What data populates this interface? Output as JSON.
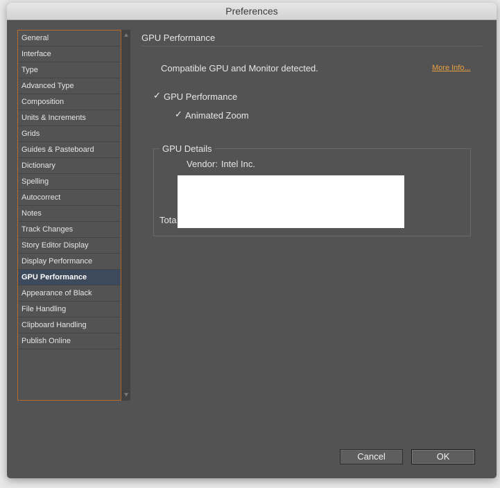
{
  "window": {
    "title": "Preferences"
  },
  "sidebar": {
    "items": [
      {
        "label": "General"
      },
      {
        "label": "Interface"
      },
      {
        "label": "Type"
      },
      {
        "label": "Advanced Type"
      },
      {
        "label": "Composition"
      },
      {
        "label": "Units & Increments"
      },
      {
        "label": "Grids"
      },
      {
        "label": "Guides & Pasteboard"
      },
      {
        "label": "Dictionary"
      },
      {
        "label": "Spelling"
      },
      {
        "label": "Autocorrect"
      },
      {
        "label": "Notes"
      },
      {
        "label": "Track Changes"
      },
      {
        "label": "Story Editor Display"
      },
      {
        "label": "Display Performance"
      },
      {
        "label": "GPU Performance",
        "selected": true
      },
      {
        "label": "Appearance of Black"
      },
      {
        "label": "File Handling"
      },
      {
        "label": "Clipboard Handling"
      },
      {
        "label": "Publish Online"
      }
    ]
  },
  "main": {
    "section_title": "GPU Performance",
    "status_text": "Compatible GPU and Monitor detected.",
    "more_info_label": "More Info...",
    "gpu_performance_checkbox": {
      "label": "GPU Performance",
      "checked": true
    },
    "animated_zoom_checkbox": {
      "label": "Animated Zoom",
      "checked": true
    },
    "details": {
      "legend": "GPU Details",
      "vendor_label": "Vendor:",
      "vendor_value": "Intel Inc.",
      "total_label_partial": "Tota"
    }
  },
  "buttons": {
    "cancel_label": "Cancel",
    "ok_label": "OK"
  },
  "colors": {
    "panel_bg": "#535353",
    "accent_border": "#b86b2a",
    "link": "#e8a040",
    "selected_item_bg": "#3d4a5b"
  }
}
